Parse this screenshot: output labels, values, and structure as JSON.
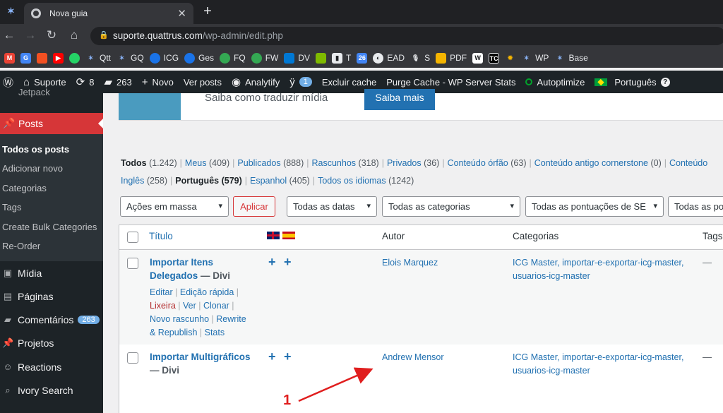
{
  "browser": {
    "tab_title": "Nova guia",
    "url_host": "suporte.quattrus.com",
    "url_path": "/wp-admin/edit.php",
    "bookmarks": [
      "Qtt",
      "GQ",
      "ICG",
      "Ges",
      "FQ",
      "FW",
      "DV",
      "T",
      "EAD",
      "S",
      "PDF",
      "WP",
      "Base"
    ]
  },
  "adminbar": {
    "site": "Suporte",
    "updates": "8",
    "comments": "263",
    "new": "Novo",
    "view_posts": "Ver posts",
    "analytify": "Analytify",
    "yoast_count": "1",
    "clear_cache": "Excluir cache",
    "purge": "Purge Cache - WP Server Stats",
    "autoptimize": "Autoptimize",
    "language": "Português"
  },
  "sidebar": {
    "jetpack": "Jetpack",
    "posts": "Posts",
    "sub": [
      "Todos os posts",
      "Adicionar novo",
      "Categorias",
      "Tags",
      "Create Bulk Categories",
      "Re-Order"
    ],
    "items": [
      "Mídia",
      "Páginas",
      "Comentários",
      "Projetos",
      "Reactions",
      "Ivory Search"
    ],
    "comments_count": "263"
  },
  "notice": {
    "text": "Saiba como traduzir mídia",
    "button": "Saiba mais"
  },
  "views": {
    "all": "Todos",
    "all_count": "(1.242)",
    "mine": "Meus",
    "mine_count": "(409)",
    "published": "Publicados",
    "published_count": "(888)",
    "drafts": "Rascunhos",
    "drafts_count": "(318)",
    "private": "Privados",
    "private_count": "(36)",
    "orphan": "Conteúdo órfão",
    "orphan_count": "(63)",
    "cornerstone": "Conteúdo antigo cornerstone",
    "cornerstone_count": "(0)",
    "more": "Conteúdo",
    "english": "Inglês",
    "english_count": "(258)",
    "portuguese": "Português",
    "portuguese_count": "(579)",
    "spanish": "Espanhol",
    "spanish_count": "(405)",
    "all_langs": "Todos os idiomas",
    "all_langs_count": "(1242)"
  },
  "filters": {
    "bulk": "Ações em massa",
    "apply": "Aplicar",
    "dates": "Todas as datas",
    "categories": "Todas as categorias",
    "seo": "Todas as pontuações de SE",
    "more": "Todas as po"
  },
  "table": {
    "headers": {
      "title": "Título",
      "author": "Autor",
      "categories": "Categorias",
      "tags": "Tags"
    },
    "rows": [
      {
        "title_l1": "Importar Itens",
        "title_l2": "Delegados",
        "state": "— Divi",
        "author": "Elois Marquez",
        "cats_l1": "ICG Master, importar-e-exportar-icg-master,",
        "cats_l2": "usuarios-icg-master",
        "tags": "—",
        "actions": {
          "edit": "Editar",
          "quick": "Edição rápida",
          "trash": "Lixeira",
          "view": "Ver",
          "clone": "Clonar",
          "draft": "Novo rascunho",
          "rewrite": "Rewrite",
          "republish": "& Republish",
          "stats": "Stats"
        }
      },
      {
        "title_l1": "Importar Multigráficos",
        "state": "— Divi",
        "author": "Andrew Mensor",
        "cats_l1": "ICG Master, importar-e-exportar-icg-master,",
        "cats_l2": "usuarios-icg-master",
        "tags": "—"
      }
    ]
  },
  "annotation": "1",
  "colors": {
    "accent": "#2271b1",
    "menu_active": "#d63638",
    "adminbar": "#1d2327",
    "arrow": "#e01e1e"
  }
}
